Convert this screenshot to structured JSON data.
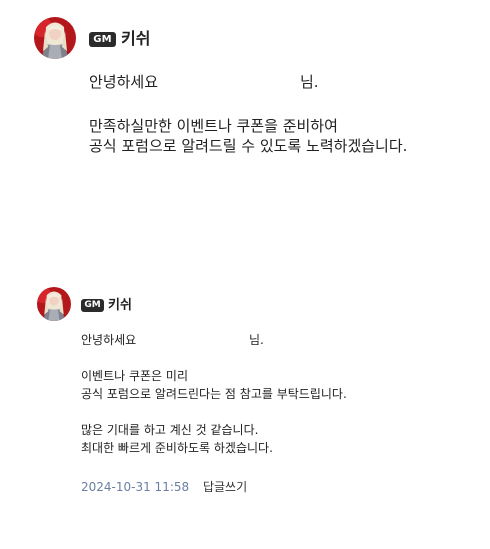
{
  "comments": [
    {
      "badge": "GM",
      "author": "키쉬",
      "greeting_prefix": "안녕하세요",
      "greeting_suffix": "님.",
      "paragraphs": [
        [
          "만족하실만한 이벤트나 쿠폰을 준비하여",
          "공식 포럼으로 알려드릴 수 있도록 노력하겠습니다."
        ]
      ]
    },
    {
      "badge": "GM",
      "author": "키쉬",
      "greeting_prefix": "안녕하세요",
      "greeting_suffix": "님.",
      "paragraphs": [
        [
          "이벤트나 쿠폰은 미리",
          "공식 포럼으로 알려드린다는 점 참고를 부탁드립니다."
        ],
        [
          "많은 기대를 하고 계신 것 같습니다.",
          "최대한 빠르게 준비하도록 하겠습니다."
        ]
      ],
      "timestamp": "2024-10-31 11:58",
      "reply_label": "답글쓰기"
    }
  ]
}
